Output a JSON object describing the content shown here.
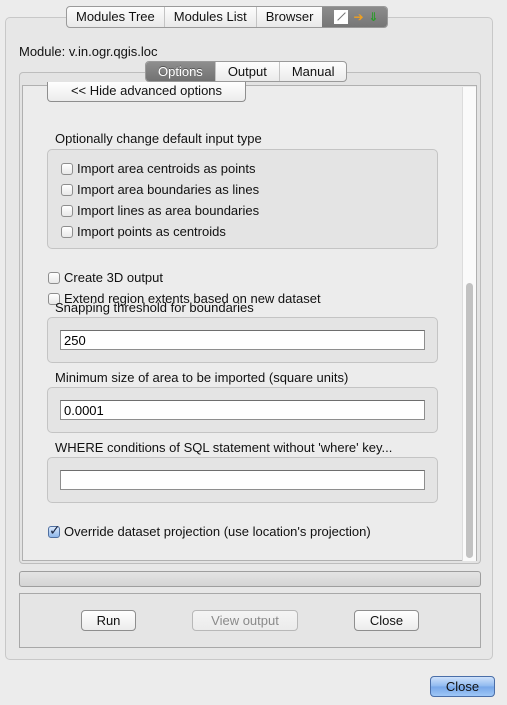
{
  "top_tabs": [
    "Modules Tree",
    "Modules List",
    "Browser"
  ],
  "toolbar_icons": [
    "edit-line-icon",
    "arrow-right-icon",
    "arrow-down-icon"
  ],
  "module": {
    "label": "Module: v.in.ogr.qgis.loc"
  },
  "inner_tabs": [
    {
      "label": "Options",
      "active": true
    },
    {
      "label": "Output",
      "active": false
    },
    {
      "label": "Manual",
      "active": false
    }
  ],
  "options": {
    "hide_advanced_label": "<< Hide advanced options",
    "input_type_section": {
      "title": "Optionally change default input type",
      "checkboxes": [
        {
          "label": "Import area centroids as points",
          "checked": false
        },
        {
          "label": "Import area boundaries as lines",
          "checked": false
        },
        {
          "label": "Import lines as area boundaries",
          "checked": false
        },
        {
          "label": "Import points as centroids",
          "checked": false
        }
      ]
    },
    "create_3d": {
      "label": "Create 3D output",
      "checked": false
    },
    "extend_region": {
      "label": "Extend region extents based on new dataset",
      "checked": false
    },
    "snapping": {
      "title": "Snapping threshold for boundaries",
      "value": "250"
    },
    "min_area": {
      "title": "Minimum size of area to be imported (square units)",
      "value": "0.0001"
    },
    "where": {
      "title": "WHERE conditions of SQL statement without 'where' key...",
      "value": ""
    },
    "override_projection": {
      "label": "Override dataset projection (use location's projection)",
      "checked": true
    }
  },
  "progress": {
    "value": 0
  },
  "buttons": {
    "run": "Run",
    "view_output": "View output",
    "close_inner": "Close",
    "close_dialog": "Close"
  },
  "scrollbar": {
    "position_fraction": 1.0
  }
}
